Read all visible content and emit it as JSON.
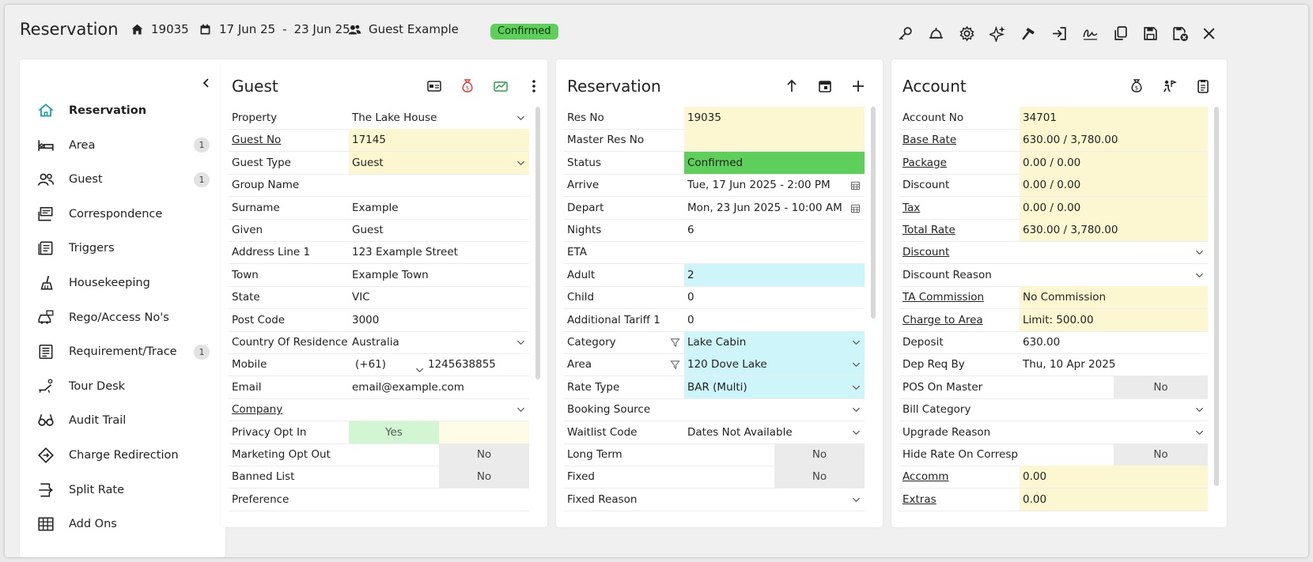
{
  "header": {
    "app_title": "Reservation",
    "res_no": "19035",
    "date_from": "17 Jun 25",
    "date_sep": "-",
    "date_to": "23 Jun 25",
    "guest_name": "Guest Example",
    "status_badge": "Confirmed"
  },
  "toolbar_icons": [
    "key-icon",
    "bell-icon",
    "gear-icon",
    "sparkle-icon",
    "hammer-icon",
    "check-in-icon",
    "signature-icon",
    "copy-icon",
    "save-icon",
    "save-close-icon",
    "close-icon"
  ],
  "sidebar": {
    "items": [
      {
        "label": "Reservation",
        "icon": "home-icon",
        "count": ""
      },
      {
        "label": "Area",
        "icon": "bed-icon",
        "count": "1"
      },
      {
        "label": "Guest",
        "icon": "users-icon",
        "count": "1"
      },
      {
        "label": "Correspondence",
        "icon": "mail-icon",
        "count": ""
      },
      {
        "label": "Triggers",
        "icon": "list-icon",
        "count": ""
      },
      {
        "label": "Housekeeping",
        "icon": "broom-icon",
        "count": ""
      },
      {
        "label": "Rego/Access No's",
        "icon": "car-icon",
        "count": ""
      },
      {
        "label": "Requirement/Trace",
        "icon": "checklist-icon",
        "count": "1"
      },
      {
        "label": "Tour Desk",
        "icon": "sunbed-icon",
        "count": ""
      },
      {
        "label": "Audit Trail",
        "icon": "glasses-icon",
        "count": ""
      },
      {
        "label": "Charge Redirection",
        "icon": "diamond-arrow-icon",
        "count": ""
      },
      {
        "label": "Split Rate",
        "icon": "split-icon",
        "count": ""
      },
      {
        "label": "Add Ons",
        "icon": "grid-icon",
        "count": ""
      }
    ]
  },
  "guest": {
    "title": "Guest",
    "rows": [
      {
        "label": "Property",
        "value": "The Lake House",
        "link": false,
        "style": "",
        "dropdown": true
      },
      {
        "label": "Guest No",
        "value": "17145",
        "link": true,
        "style": "yellow",
        "dropdown": false
      },
      {
        "label": "Guest Type",
        "value": "Guest",
        "link": false,
        "style": "yellow",
        "dropdown": true
      },
      {
        "label": "Group Name",
        "value": "",
        "link": false,
        "style": "",
        "dropdown": false
      },
      {
        "label": "Surname",
        "value": "Example",
        "link": false,
        "style": "",
        "dropdown": false
      },
      {
        "label": "Given",
        "value": "Guest",
        "link": false,
        "style": "",
        "dropdown": false
      },
      {
        "label": "Address Line 1",
        "value": "123 Example Street",
        "link": false,
        "style": "",
        "dropdown": false
      },
      {
        "label": "Town",
        "value": "Example Town",
        "link": false,
        "style": "",
        "dropdown": false
      },
      {
        "label": "State",
        "value": "VIC",
        "link": false,
        "style": "",
        "dropdown": false
      },
      {
        "label": "Post Code",
        "value": "3000",
        "link": false,
        "style": "",
        "dropdown": false
      },
      {
        "label": "Country Of Residence",
        "value": "Australia",
        "link": false,
        "style": "",
        "dropdown": true
      },
      {
        "label": "Mobile",
        "value": "1245638855",
        "link": false,
        "style": "",
        "dropdown": false,
        "prefix": "(+61)"
      },
      {
        "label": "Email",
        "value": "email@example.com",
        "link": false,
        "style": "",
        "dropdown": false
      },
      {
        "label": "Company",
        "value": "",
        "link": true,
        "style": "",
        "dropdown": true
      },
      {
        "label": "Privacy Opt In",
        "value": "Yes",
        "link": false,
        "style": "toggle-yes",
        "dropdown": false
      },
      {
        "label": "Marketing Opt Out",
        "value": "No",
        "link": false,
        "style": "toggle-no",
        "dropdown": false
      },
      {
        "label": "Banned List",
        "value": "No",
        "link": false,
        "style": "toggle-no",
        "dropdown": false
      },
      {
        "label": "Preference",
        "value": "",
        "link": false,
        "style": "",
        "dropdown": false
      }
    ]
  },
  "reservation": {
    "title": "Reservation",
    "rows": [
      {
        "label": "Res No",
        "value": "19035",
        "style": "yellow"
      },
      {
        "label": "Master Res No",
        "value": "",
        "style": "yellow"
      },
      {
        "label": "Status",
        "value": "Confirmed",
        "style": "green"
      },
      {
        "label": "Arrive",
        "value": "Tue, 17 Jun 2025 - 2:00 PM",
        "style": "",
        "calendar": true
      },
      {
        "label": "Depart",
        "value": "Mon, 23 Jun 2025 - 10:00 AM",
        "style": "",
        "calendar": true
      },
      {
        "label": "Nights",
        "value": "6",
        "style": ""
      },
      {
        "label": "ETA",
        "value": "",
        "style": ""
      },
      {
        "label": "Adult",
        "value": "2",
        "style": "cyan"
      },
      {
        "label": "Child",
        "value": "0",
        "style": ""
      },
      {
        "label": "Additional Tariff 1",
        "value": "0",
        "style": ""
      },
      {
        "label": "Category",
        "value": "Lake Cabin",
        "style": "cyan",
        "dropdown": true,
        "filter": true
      },
      {
        "label": "Area",
        "value": "120 Dove Lake",
        "style": "cyan",
        "dropdown": true,
        "filter": true
      },
      {
        "label": "Rate Type",
        "value": "BAR (Multi)",
        "style": "cyan",
        "dropdown": true
      },
      {
        "label": "Booking Source",
        "value": "",
        "style": "",
        "dropdown": true
      },
      {
        "label": "Waitlist Code",
        "value": "Dates Not Available",
        "style": "",
        "dropdown": true
      },
      {
        "label": "Long Term",
        "value": "No",
        "style": "toggle-no"
      },
      {
        "label": "Fixed",
        "value": "No",
        "style": "toggle-no"
      },
      {
        "label": "Fixed Reason",
        "value": "",
        "style": "",
        "dropdown": true
      }
    ]
  },
  "account": {
    "title": "Account",
    "rows": [
      {
        "label": "Account No",
        "value": "34701",
        "link": false,
        "style": "yellow"
      },
      {
        "label": "Base Rate",
        "value": "630.00 / 3,780.00",
        "link": true,
        "style": "yellow"
      },
      {
        "label": "Package",
        "value": "0.00 / 0.00",
        "link": true,
        "style": "yellow"
      },
      {
        "label": "Discount",
        "value": "0.00 / 0.00",
        "link": false,
        "style": "yellow"
      },
      {
        "label": "Tax",
        "value": "0.00 / 0.00",
        "link": true,
        "style": "yellow"
      },
      {
        "label": "Total Rate",
        "value": "630.00 / 3,780.00",
        "link": true,
        "style": "yellow"
      },
      {
        "label": "Discount",
        "value": "",
        "link": true,
        "style": "",
        "dropdown": true
      },
      {
        "label": "Discount Reason",
        "value": "",
        "link": false,
        "style": "",
        "dropdown": true
      },
      {
        "label": "TA Commission",
        "value": "No Commission",
        "link": true,
        "style": "yellow"
      },
      {
        "label": "Charge to Area",
        "value": "Limit: 500.00",
        "link": true,
        "style": "yellow"
      },
      {
        "label": "Deposit",
        "value": "630.00",
        "link": false,
        "style": ""
      },
      {
        "label": "Dep Req By",
        "value": "Thu, 10 Apr 2025",
        "link": false,
        "style": ""
      },
      {
        "label": "POS On Master",
        "value": "No",
        "link": false,
        "style": "toggle-no"
      },
      {
        "label": "Bill Category",
        "value": "",
        "link": false,
        "style": "",
        "dropdown": true
      },
      {
        "label": "Upgrade Reason",
        "value": "",
        "link": false,
        "style": "",
        "dropdown": true
      },
      {
        "label": "Hide Rate On Correspon...",
        "value": "No",
        "link": false,
        "style": "toggle-no"
      },
      {
        "label": "Accomm",
        "value": "0.00",
        "link": true,
        "style": "yellow"
      },
      {
        "label": "Extras",
        "value": "0.00",
        "link": true,
        "style": "yellow"
      }
    ]
  },
  "colors": {
    "yellow": "#fdf7d1",
    "green": "#5ecf5a",
    "cyan": "#cdf5fa",
    "accent_red": "#e53935",
    "accent_green": "#2e9e4a",
    "active_nav": "#17a3a3"
  }
}
